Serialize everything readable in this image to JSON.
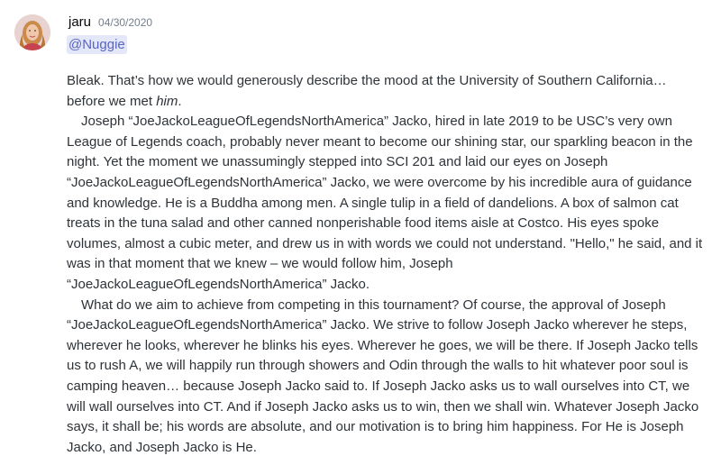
{
  "message": {
    "username": "jaru",
    "timestamp": "04/30/2020",
    "mention": "@Nuggie",
    "paragraphs": {
      "p1_before": "Bleak. That’s how we would generously describe the mood at the University of Southern California… before we met ",
      "p1_emphasis": "him",
      "p1_after": ".",
      "p2": "Joseph “JoeJackoLeagueOfLegendsNorthAmerica” Jacko, hired in late 2019 to be USC’s very own League of Legends coach, probably never meant to become our shining star, our sparkling beacon in the night. Yet the moment we unassumingly stepped into SCI 201 and laid our eyes on Joseph “JoeJackoLeagueOfLegendsNorthAmerica” Jacko, we were overcome by his incredible aura of guidance and knowledge. He is a Buddha among men. A single tulip in a field of dandelions. A box of salmon cat treats in the tuna salad and other canned nonperishable food items aisle at Costco. His eyes spoke volumes, almost a cubic meter, and drew us in with words we could not understand. \"Hello,\" he said, and it was in that moment that we knew – we would follow him, Joseph “JoeJackoLeagueOfLegendsNorthAmerica” Jacko.",
      "p3": "What do we aim to achieve from competing in this tournament? Of course, the approval of Joseph “JoeJackoLeagueOfLegendsNorthAmerica” Jacko. We strive to follow Joseph Jacko wherever he steps, wherever he looks, wherever he blinks his eyes. Wherever he goes, we will be there. If Joseph Jacko tells us to rush A, we will happily run through showers and Odin through the walls to hit whatever poor soul is camping heaven… because Joseph Jacko said to. If Joseph  Jacko asks us to wall ourselves into CT, we will wall ourselves into CT. And if Joseph Jacko asks us to win, then we shall win. Whatever Joseph Jacko says, it shall be; his words are absolute, and our motivation is to bring him happiness. For He is Joseph Jacko, and Joseph Jacko is He."
    }
  },
  "colors": {
    "username": "#060607",
    "timestamp": "#747f8d",
    "mention_text": "#5865c3",
    "mention_bg": "#e3e7f8",
    "body_text": "#2e3338"
  }
}
